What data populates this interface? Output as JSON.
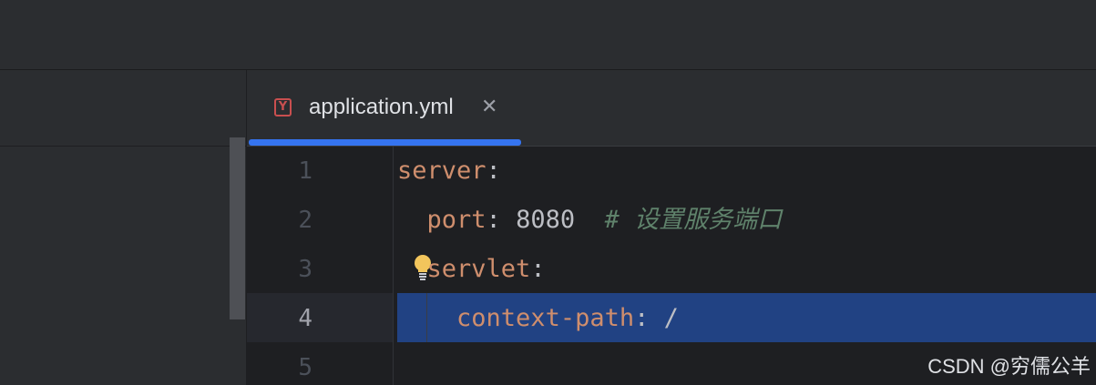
{
  "tabs": [
    {
      "label": "application.yml",
      "icon": "yaml-file-icon",
      "icon_glyph": "Y",
      "active": true
    }
  ],
  "editor": {
    "line_numbers": [
      "1",
      "2",
      "3",
      "4",
      "5"
    ],
    "current_line": 4,
    "lines": [
      {
        "key": "server",
        "colon": ":"
      },
      {
        "key": "port",
        "colon": ":",
        "value": " 8080",
        "comment": "# 设置服务端口"
      },
      {
        "key": "servlet",
        "colon": ":"
      },
      {
        "key": "context-path",
        "colon": ":",
        "value": " /"
      },
      {
        "key": ""
      }
    ]
  },
  "watermark": "CSDN @穷儒公羊",
  "colors": {
    "accent": "#3574f0",
    "selection": "#214283",
    "key": "#cf8e6d",
    "comment": "#5f826b",
    "bulb": "#f2c55c",
    "yaml_icon": "#c94f4f"
  }
}
